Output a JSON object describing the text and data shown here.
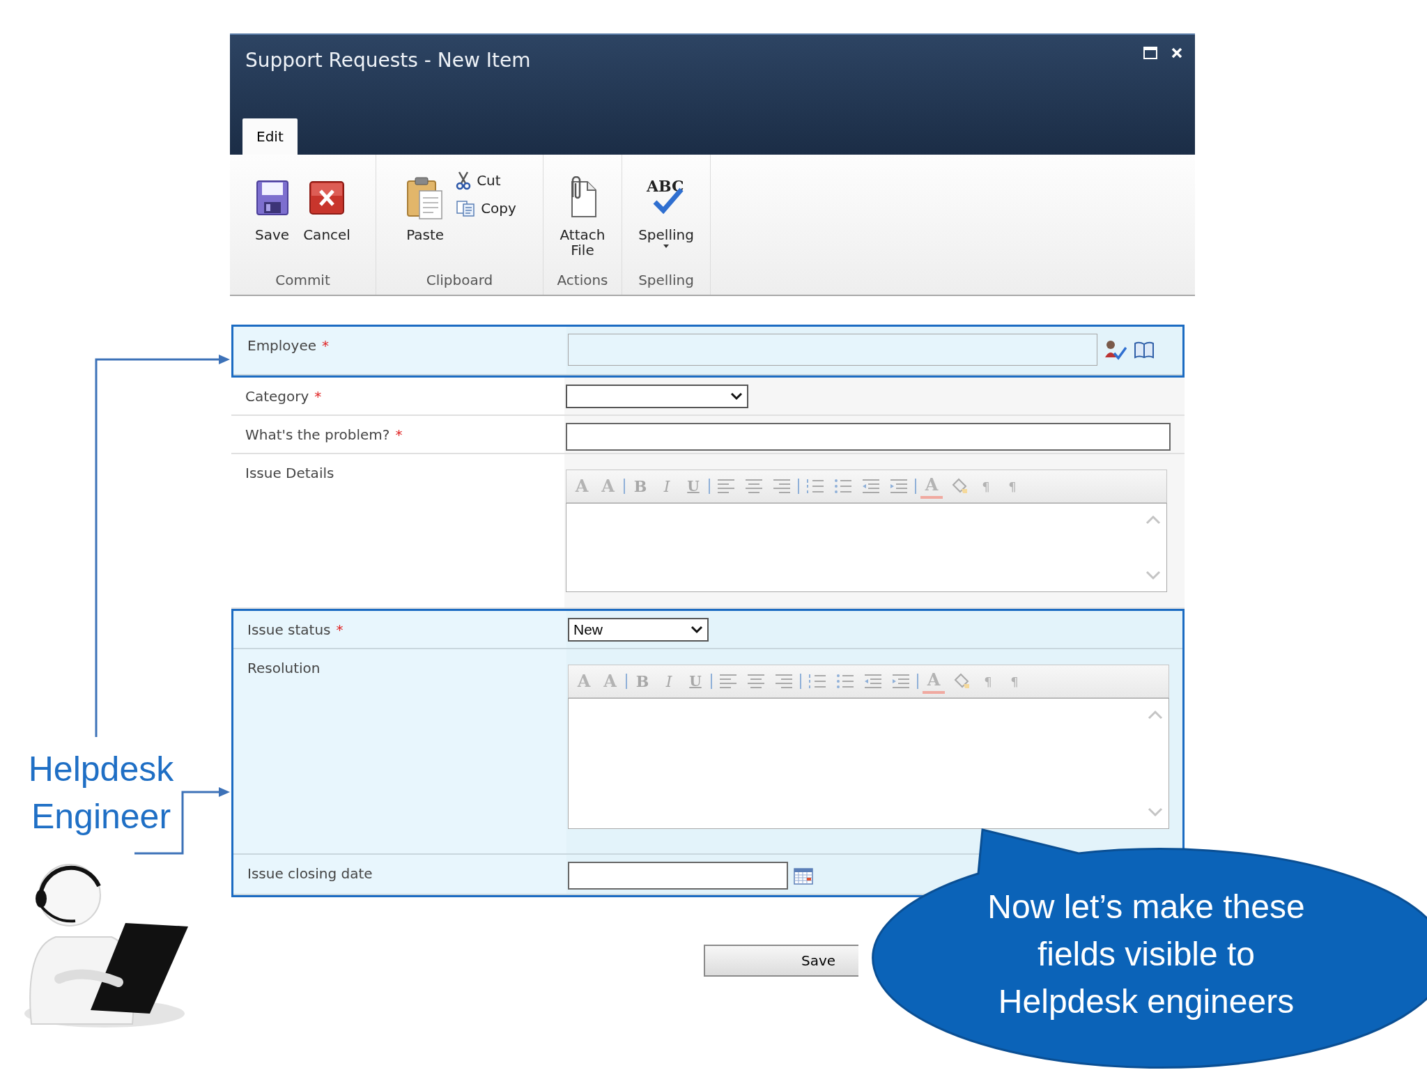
{
  "window": {
    "title": "Support Requests - New Item"
  },
  "ribbon": {
    "tabs": [
      {
        "label": "Edit",
        "selected": true
      }
    ],
    "groups": [
      {
        "label": "Commit",
        "buttons": [
          {
            "kind": "save",
            "label": "Save"
          },
          {
            "kind": "cancel",
            "label": "Cancel"
          }
        ]
      },
      {
        "label": "Clipboard",
        "buttons": [
          {
            "kind": "paste",
            "label": "Paste"
          },
          {
            "kind": "cut",
            "label": "Cut"
          },
          {
            "kind": "copy",
            "label": "Copy"
          }
        ]
      },
      {
        "label": "Actions",
        "buttons": [
          {
            "kind": "attach",
            "label": "Attach File"
          }
        ]
      },
      {
        "label": "Spelling",
        "buttons": [
          {
            "kind": "spelling",
            "label": "Spelling",
            "icon_text": "ABC",
            "dropdown": true
          }
        ]
      }
    ]
  },
  "form": {
    "sections": [
      {
        "highlighted": true,
        "fields": [
          {
            "kind": "people",
            "label": "Employee",
            "marker": "*"
          }
        ]
      },
      {
        "highlighted": false,
        "fields": [
          {
            "kind": "choice",
            "label": "Category",
            "marker": "*"
          },
          {
            "kind": "text",
            "label": "What's the problem?",
            "marker": "*"
          },
          {
            "kind": "richtext",
            "label": "Issue Details",
            "toolbar": [
              {
                "kind": "font",
                "text": "A"
              },
              {
                "kind": "size",
                "text": "A"
              },
              {
                "kind": "sep"
              },
              {
                "kind": "bold",
                "text": "B"
              },
              {
                "kind": "italic",
                "text": "I"
              },
              {
                "kind": "underline",
                "text": "U"
              },
              {
                "kind": "sep"
              },
              {
                "kind": "align-left"
              },
              {
                "kind": "align-center"
              },
              {
                "kind": "align-right"
              },
              {
                "kind": "sep"
              },
              {
                "kind": "numbered"
              },
              {
                "kind": "bulleted"
              },
              {
                "kind": "outdent"
              },
              {
                "kind": "indent"
              },
              {
                "kind": "sep"
              },
              {
                "kind": "text-color",
                "text": "A"
              },
              {
                "kind": "highlight"
              },
              {
                "kind": "ltr",
                "text": "¶"
              },
              {
                "kind": "rtl",
                "text": "¶"
              }
            ]
          }
        ]
      },
      {
        "highlighted": true,
        "fields": [
          {
            "kind": "choice",
            "label": "Issue status",
            "marker": "*",
            "value": "New"
          },
          {
            "kind": "richtext",
            "label": "Resolution",
            "toolbar": [
              {
                "kind": "font",
                "text": "A"
              },
              {
                "kind": "size",
                "text": "A"
              },
              {
                "kind": "sep"
              },
              {
                "kind": "bold",
                "text": "B"
              },
              {
                "kind": "italic",
                "text": "I"
              },
              {
                "kind": "underline",
                "text": "U"
              },
              {
                "kind": "sep"
              },
              {
                "kind": "align-left"
              },
              {
                "kind": "align-center"
              },
              {
                "kind": "align-right"
              },
              {
                "kind": "sep"
              },
              {
                "kind": "numbered"
              },
              {
                "kind": "bulleted"
              },
              {
                "kind": "outdent"
              },
              {
                "kind": "indent"
              },
              {
                "kind": "sep"
              },
              {
                "kind": "text-color",
                "text": "A"
              },
              {
                "kind": "highlight"
              },
              {
                "kind": "ltr",
                "text": "¶"
              },
              {
                "kind": "rtl",
                "text": "¶"
              }
            ]
          },
          {
            "kind": "date",
            "label": "Issue closing date"
          }
        ]
      }
    ],
    "buttons": [
      "Save"
    ]
  },
  "annotation": {
    "lines": [
      "Helpdesk",
      "Engineer"
    ]
  },
  "callout": {
    "lines": [
      "Now let’s make these",
      "fields visible to",
      "Helpdesk engineers"
    ]
  }
}
